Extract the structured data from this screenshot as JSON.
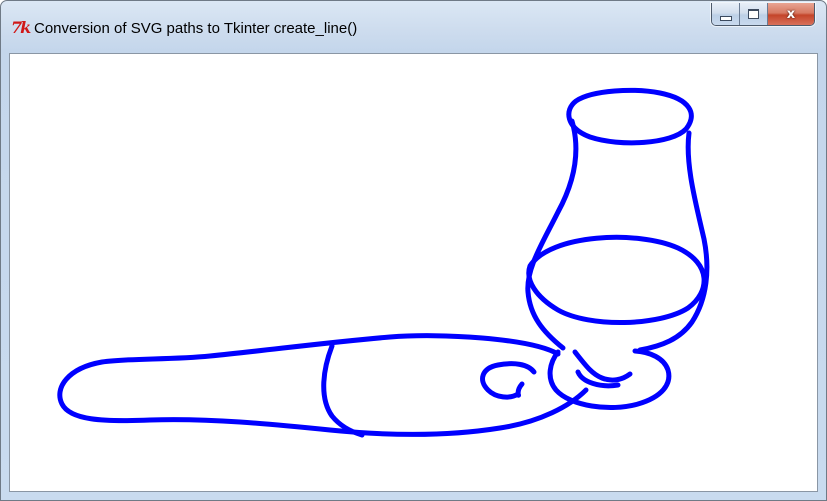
{
  "window": {
    "title": "Conversion of SVG paths to Tkinter create_line()",
    "app_icon": "tk-feather-icon",
    "app_icon_text": "7k",
    "controls": {
      "minimize_icon": "minimize-icon",
      "maximize_icon": "maximize-icon",
      "close_icon": "close-icon",
      "close_glyph": "x"
    }
  },
  "canvas": {
    "background": "#ffffff",
    "stroke_color": "#0000ff",
    "drawing": "blue line drawing of a glass on a plate next to a pipe-shaped object"
  }
}
